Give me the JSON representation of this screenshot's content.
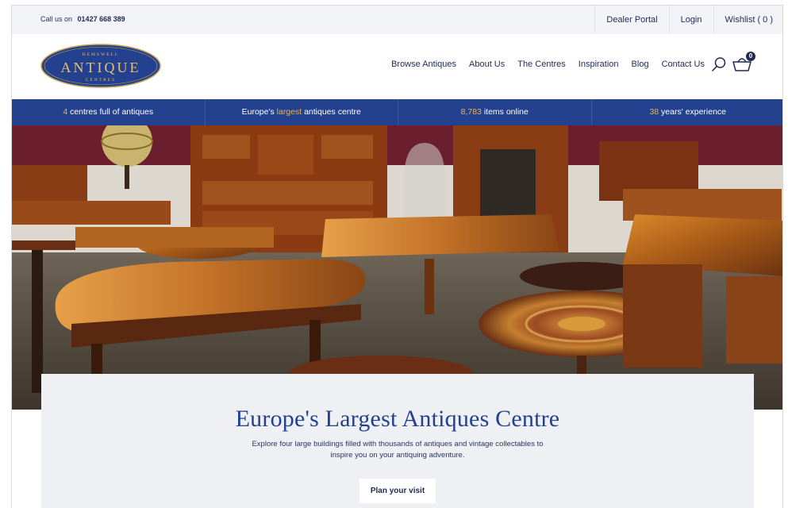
{
  "topbar": {
    "call_label": "Call us on",
    "phone": "01427 668 389",
    "links": [
      "Dealer Portal",
      "Login",
      "Wishlist ( 0 )"
    ]
  },
  "logo": {
    "line1": "HEMSWELL",
    "line2": "ANTIQUE",
    "line3": "CENTRES"
  },
  "nav": [
    "Browse Antiques",
    "About Us",
    "The Centres",
    "Inspiration",
    "Blog",
    "Contact Us"
  ],
  "basket": {
    "count": "0"
  },
  "stats": [
    {
      "lead": "4",
      "text": " centres full of antiques"
    },
    {
      "pre": "Europe's ",
      "highlight": "largest",
      "post": " antiques centre"
    },
    {
      "lead": "8,783",
      "text": " items online"
    },
    {
      "lead": "38",
      "text": " years' experience"
    }
  ],
  "hero": {
    "title": "Europe's Largest Antiques Centre",
    "subtitle": "Explore four large buildings filled with thousands of antiques and vintage collectables to inspire you on your antiquing adventure.",
    "cta": "Plan your visit"
  },
  "colors": {
    "navy": "#1f2a56",
    "stats_blue": "#24418f",
    "gold": "#f2b24a"
  }
}
